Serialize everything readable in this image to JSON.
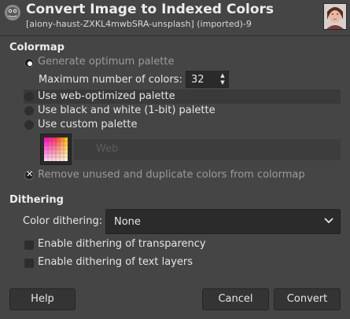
{
  "dialog": {
    "title": "Convert Image to Indexed Colors",
    "subtitle": "[aiony-haust-ZXKL4mwbSRA-unsplash] (imported)-9"
  },
  "colormap": {
    "section_title": "Colormap",
    "options": [
      {
        "label": "Generate optimum palette",
        "selected": true
      },
      {
        "label": "Use web-optimized palette",
        "selected": false
      },
      {
        "label": "Use black and white (1-bit) palette",
        "selected": false
      },
      {
        "label": "Use custom palette",
        "selected": false
      }
    ],
    "max_colors_label": "Maximum number of colors:",
    "max_colors_value": "32",
    "custom_palette_name": "Web",
    "remove_unused_label": "Remove unused and duplicate colors from colormap",
    "remove_unused_checked": true
  },
  "dithering": {
    "section_title": "Dithering",
    "color_dithering_label": "Color dithering:",
    "color_dithering_value": "None",
    "transparency_label": "Enable dithering of transparency",
    "transparency_checked": false,
    "text_layers_label": "Enable dithering of text layers",
    "text_layers_checked": false
  },
  "buttons": {
    "help": "Help",
    "cancel": "Cancel",
    "convert": "Convert"
  },
  "icons": {
    "app": "gimp-wilber-icon",
    "image_thumbnail": "image-thumbnail",
    "spin_up": "chevron-up-icon",
    "spin_down": "chevron-down-icon",
    "dropdown": "chevron-down-icon"
  }
}
